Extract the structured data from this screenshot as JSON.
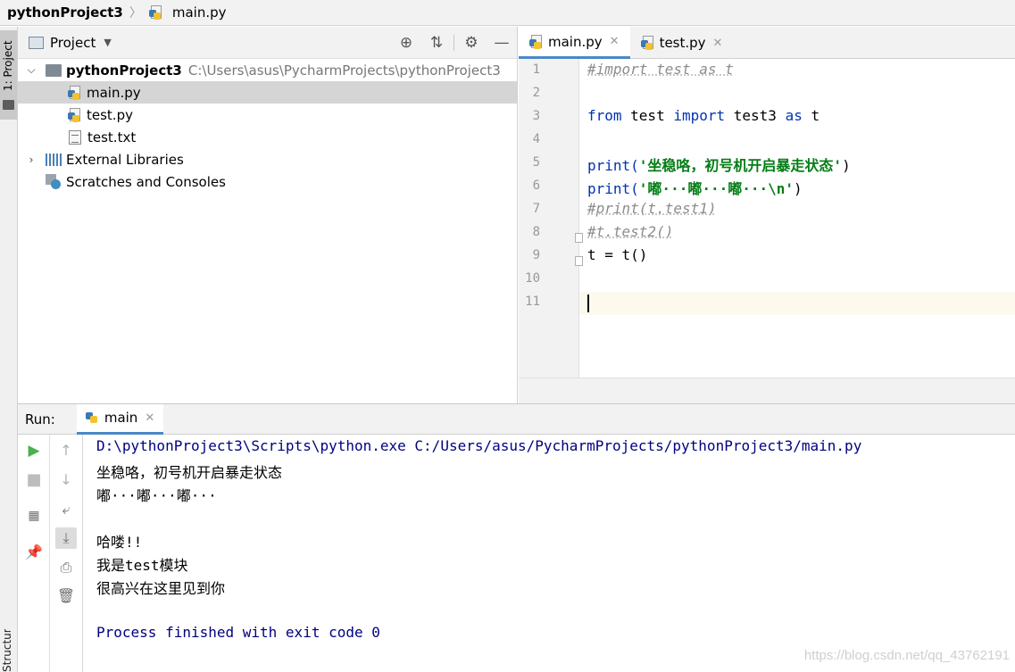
{
  "breadcrumb": {
    "project": "pythonProject3",
    "file": "main.py"
  },
  "tool_windows": {
    "project_tab": "1: Project",
    "structure_tab": "Structure"
  },
  "project_panel": {
    "title": "Project",
    "root": {
      "name": "pythonProject3",
      "path": "C:\\Users\\asus\\PycharmProjects\\pythonProject3"
    },
    "files": [
      "main.py",
      "test.py",
      "test.txt"
    ],
    "external_libraries": "External Libraries",
    "scratches": "Scratches and Consoles"
  },
  "editor": {
    "tabs": [
      {
        "label": "main.py"
      },
      {
        "label": "test.py"
      }
    ],
    "line_numbers": [
      "1",
      "2",
      "3",
      "4",
      "5",
      "6",
      "7",
      "8",
      "9",
      "10",
      "11"
    ],
    "code": {
      "l1": "#import test as t",
      "l3_from": "from",
      "l3_mod": " test ",
      "l3_import": "import",
      "l3_name": " test3 ",
      "l3_as": "as",
      "l3_alias": " t",
      "l5_fn": "print(",
      "l5_str": "'坐稳咯，初号机开启暴走状态'",
      "l5_end": ")",
      "l6_fn": "print(",
      "l6_str": "'嘟···嘟···嘟···\\n'",
      "l6_end": ")",
      "l7": "#print(t.test1)",
      "l8": "#t.test2()",
      "l9": "t = t()"
    }
  },
  "run": {
    "label": "Run:",
    "tab": "main",
    "output": {
      "command": "D:\\pythonProject3\\Scripts\\python.exe C:/Users/asus/PycharmProjects/pythonProject3/main.py",
      "line1": "坐稳咯，初号机开启暴走状态",
      "line2": "嘟···嘟···嘟···",
      "line3": "哈喽!!",
      "line4": "我是test模块",
      "line5": "很高兴在这里见到你",
      "exit": "Process finished with exit code 0"
    }
  },
  "watermark": "https://blog.csdn.net/qq_43762191",
  "colors": {
    "keyword": "#0033b3",
    "string": "#067d17",
    "comment": "#8c8c8c",
    "accent": "#4a88c7"
  }
}
